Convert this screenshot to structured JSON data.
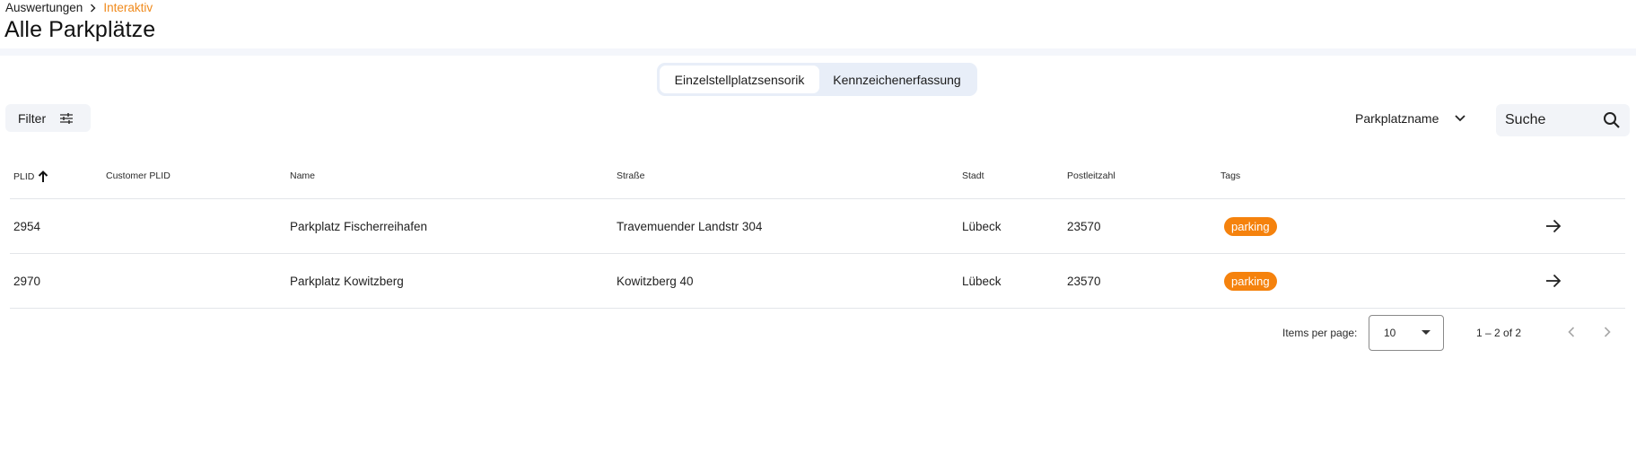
{
  "breadcrumb": {
    "parent": "Auswertungen",
    "current": "Interaktiv"
  },
  "page": {
    "title": "Alle Parkplätze"
  },
  "tabs": [
    {
      "label": "Einzelstellplatzsensorik",
      "active": true
    },
    {
      "label": "Kennzeichenerfassung",
      "active": false
    }
  ],
  "toolbar": {
    "filter_label": "Filter",
    "sort_label": "Parkplatzname",
    "search_placeholder": "Suche"
  },
  "table": {
    "columns": [
      "PLID",
      "Customer PLID",
      "Name",
      "Straße",
      "Stadt",
      "Postleitzahl",
      "Tags"
    ],
    "sort_column": "PLID",
    "sort_direction": "ascending",
    "rows": [
      {
        "plid": "2954",
        "customer_plid": "",
        "name": "Parkplatz Fischerreihafen",
        "street": "Travemuender Landstr 304",
        "city": "Lübeck",
        "zip": "23570",
        "tag": "parking"
      },
      {
        "plid": "2970",
        "customer_plid": "",
        "name": "Parkplatz Kowitzberg",
        "street": "Kowitzberg 40",
        "city": "Lübeck",
        "zip": "23570",
        "tag": "parking"
      }
    ]
  },
  "paginator": {
    "items_per_page_label": "Items per page:",
    "page_size": "10",
    "range": "1 – 2 of 2"
  },
  "colors": {
    "accent": "#f08a1c",
    "tag_bg": "#f5820d",
    "tab_group_bg": "#e8eef8"
  }
}
